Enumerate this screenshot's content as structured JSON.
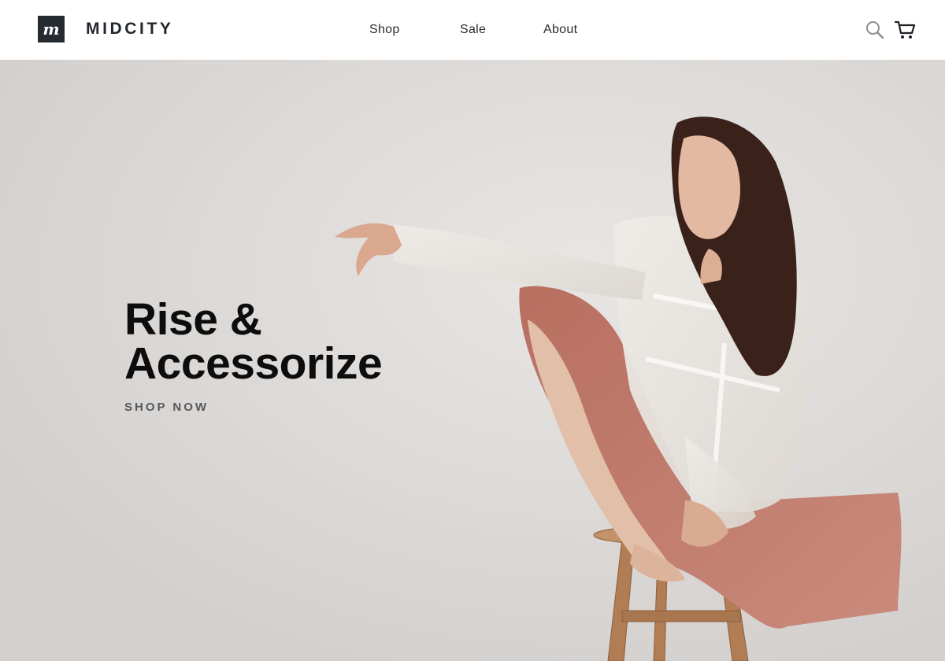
{
  "header": {
    "brand": "MIDCITY",
    "nav": {
      "shop": "Shop",
      "sale": "Sale",
      "about": "About"
    },
    "icons": {
      "search": "search-icon",
      "cart": "cart-icon"
    }
  },
  "hero": {
    "headline_line1": "Rise &",
    "headline_line2": "Accessorize",
    "cta": "SHOP NOW",
    "image": "woman-in-white-shirt-and-pink-pants-sitting-on-wooden-stool"
  },
  "colors": {
    "logo_bg": "#262b31",
    "hero_bg": "#dcdad8",
    "headline": "#0d0d0d",
    "cta": "#55585c",
    "pants": "#c17c6d",
    "stool": "#b5825a"
  }
}
